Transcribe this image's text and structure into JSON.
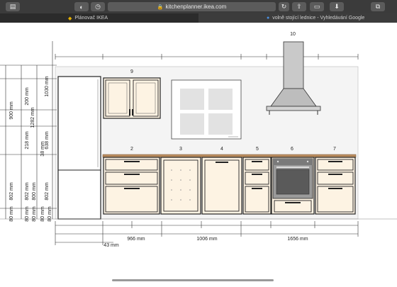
{
  "browser": {
    "url": "kitchenplanner.ikea.com",
    "tabs": [
      {
        "label": "Plánovač IKEA"
      },
      {
        "label": "volně stojící lednice - Vyhledávání Google"
      }
    ]
  },
  "icons": {
    "sidebar": "sidebar-icon",
    "privacy": "shield-icon",
    "history": "clock-icon",
    "lock": "lock-icon",
    "reload": "reload-icon",
    "share": "share-icon",
    "tab_overview": "tabs-icon",
    "download": "download-icon",
    "bookmark": "bookmark-icon"
  },
  "plan": {
    "units": [
      {
        "num": "2"
      },
      {
        "num": "3"
      },
      {
        "num": "4"
      },
      {
        "num": "5"
      },
      {
        "num": "6"
      },
      {
        "num": "7"
      },
      {
        "num": "9"
      },
      {
        "num": "10"
      }
    ],
    "dimensions": {
      "left_tall": [
        "1030 mm",
        "900 mm",
        "200 mm",
        "1282 mm",
        "218 mm",
        "638 mm",
        "38 mm"
      ],
      "left_base": [
        "802 mm",
        "802 mm",
        "800 mm",
        "802 mm"
      ],
      "left_plinth": [
        "80 mm",
        "80 mm",
        "80 mm",
        "80 mm",
        "80 mm"
      ],
      "bottom": [
        "966 mm",
        "1006 mm",
        "1656 mm",
        "43 mm"
      ]
    }
  }
}
